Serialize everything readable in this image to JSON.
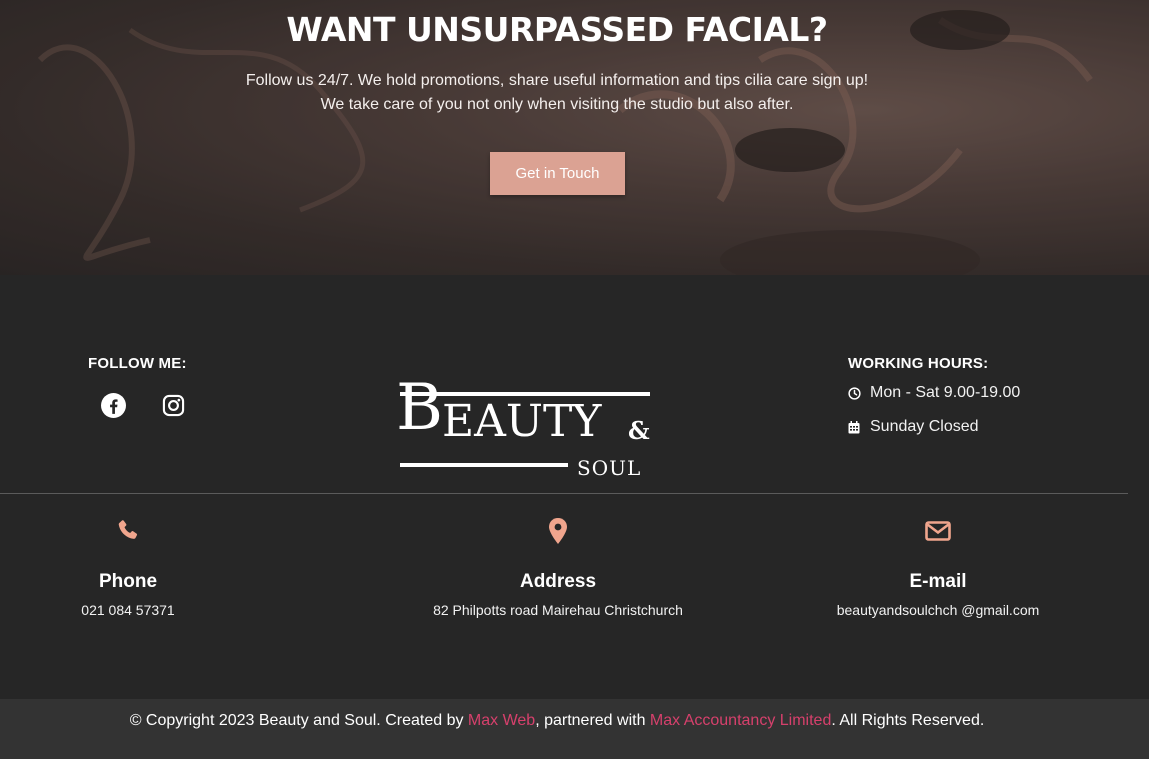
{
  "hero": {
    "title": "WANT UNSURPASSED FACIAL?",
    "text_line1": "Follow us 24/7. We hold promotions, share useful information and tips cilia care sign up!",
    "text_line2": "We take care of you not only when visiting the studio but also after.",
    "cta_label": "Get in Touch"
  },
  "follow": {
    "title": "FOLLOW ME:",
    "icons": [
      "facebook-icon",
      "instagram-icon"
    ]
  },
  "logo": {
    "big": "B",
    "word": "EAUTY",
    "amp": "&",
    "soul": "SOUL"
  },
  "hours": {
    "title": "WORKING HOURS:",
    "weekdays": "Mon - Sat 9.00-19.00",
    "sunday": "Sunday Closed"
  },
  "contacts": {
    "phone": {
      "title": "Phone",
      "value": "021 084 57371"
    },
    "address": {
      "title": "Address",
      "value": "82 Philpotts road Mairehau Christchurch"
    },
    "email": {
      "title": "E-mail",
      "value": "beautyandsoulchch @gmail.com"
    }
  },
  "footer": {
    "copy_prefix": "© Copyright 2023 Beauty and Soul. Created by ",
    "link1": "Max Web",
    "copy_mid": ", partnered with ",
    "link2": "Max Accountancy Limited",
    "copy_suffix": ". All Rights Reserved."
  },
  "colors": {
    "accent": "#dba293",
    "icon_accent": "#f0a58d",
    "link": "#d6406c",
    "footer_bg": "#262626",
    "bottom_bg": "#333333"
  }
}
